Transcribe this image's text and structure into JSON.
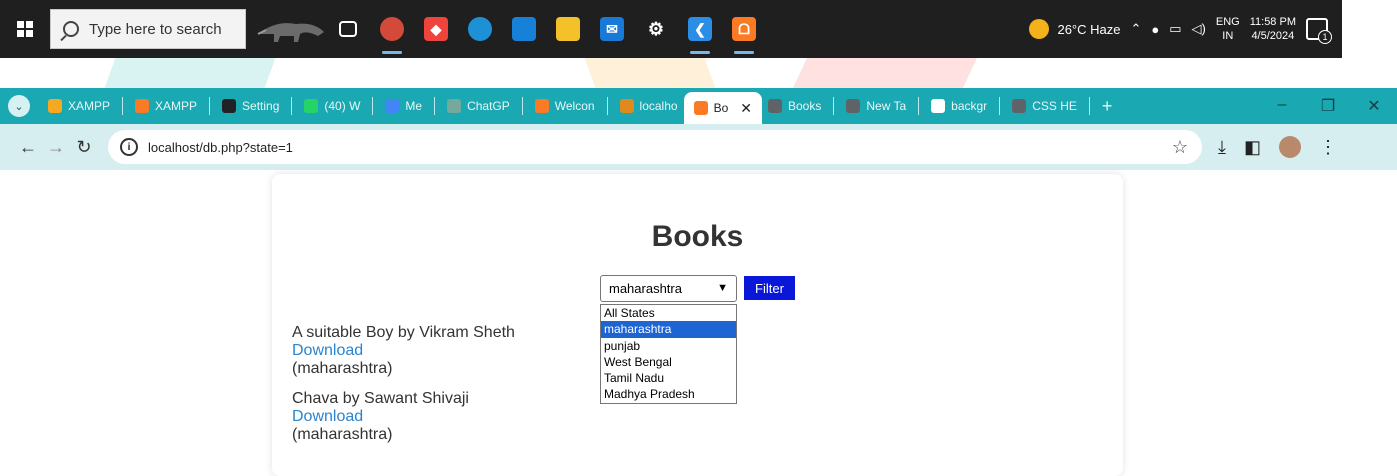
{
  "taskbar": {
    "search_placeholder": "Type here to search",
    "weather": "26°C  Haze",
    "lang_top": "ENG",
    "lang_bottom": "IN",
    "time": "11:58 PM",
    "date": "4/5/2024",
    "notification_count": "1"
  },
  "tabs": [
    {
      "label": "XAMPP",
      "color": "#f7a823"
    },
    {
      "label": "XAMPP",
      "color": "#fb7a24"
    },
    {
      "label": "Setting",
      "color": "#222222"
    },
    {
      "label": "(40) W",
      "color": "#25d366"
    },
    {
      "label": "Me",
      "color": "#4285f4"
    },
    {
      "label": "ChatGP",
      "color": "#74aa9c"
    },
    {
      "label": "Welcon",
      "color": "#fb7a24"
    },
    {
      "label": "localho",
      "color": "#e08a1e"
    },
    {
      "label": "Bo",
      "color": "#fb7a24"
    },
    {
      "label": "Books",
      "color": "#5f6368"
    },
    {
      "label": "New Ta",
      "color": "#5f6368"
    },
    {
      "label": "backgr",
      "color": "#ffffff"
    },
    {
      "label": "CSS HE",
      "color": "#5f6368"
    }
  ],
  "address": {
    "url": "localhost/db.php?state=1"
  },
  "page": {
    "title": "Books",
    "select_value": "maharashtra",
    "filter_label": "Filter",
    "options": [
      "All States",
      "maharashtra",
      "punjab",
      "West Bengal",
      "Tamil Nadu",
      "Madhya Pradesh"
    ],
    "books": [
      {
        "title": "A suitable Boy by Vikram Sheth",
        "link": "Download",
        "state": "(maharashtra)"
      },
      {
        "title": "Chava by Sawant Shivaji",
        "link": "Download",
        "state": "(maharashtra)"
      }
    ]
  }
}
